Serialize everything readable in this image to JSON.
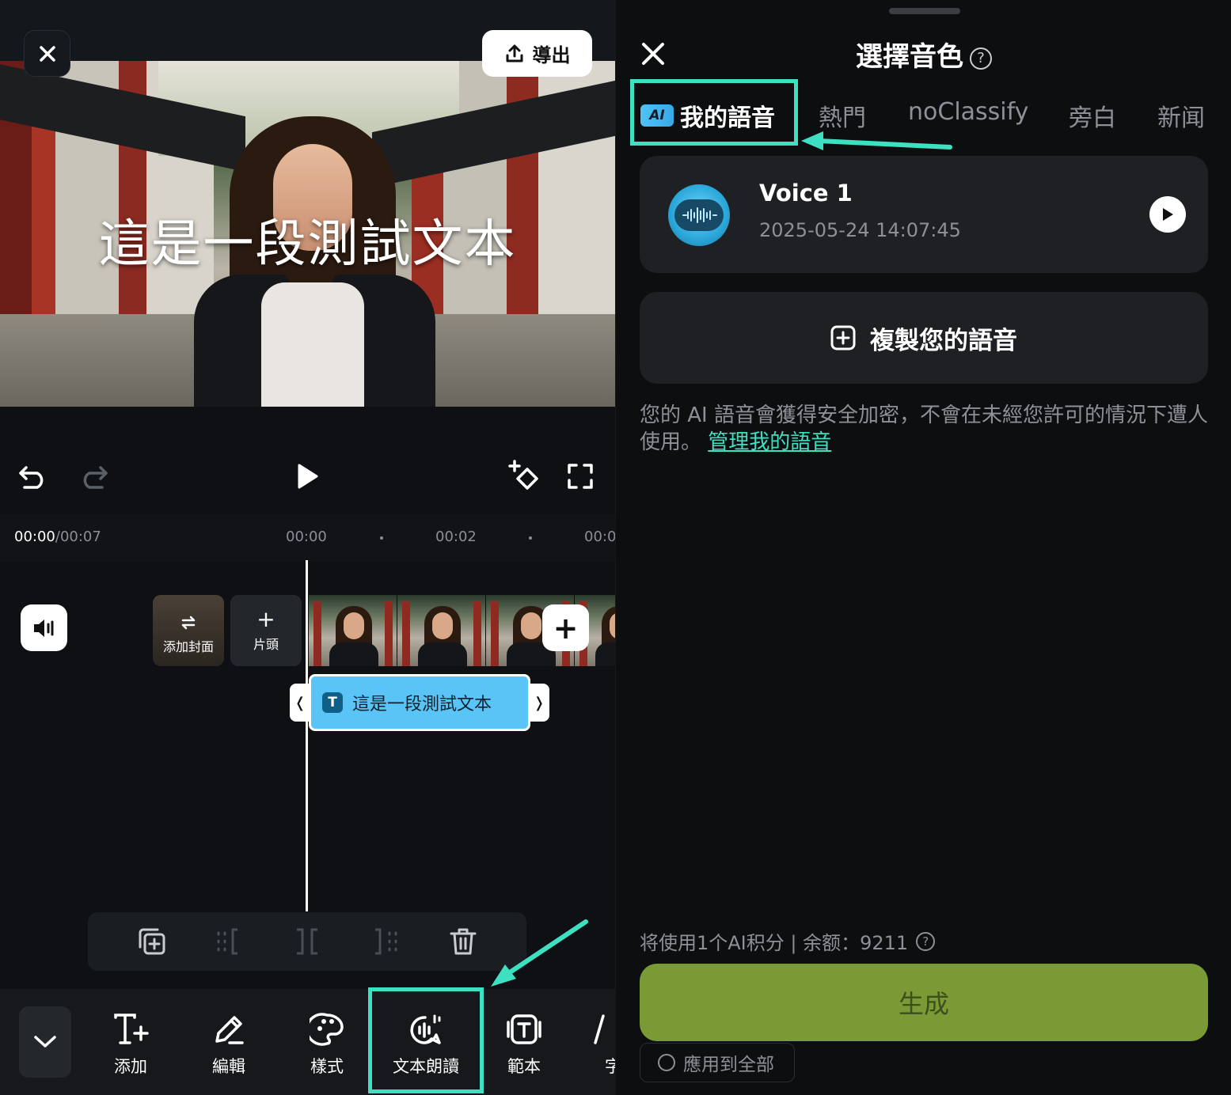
{
  "editor": {
    "export_label": "導出",
    "caption": "這是一段測試文本",
    "time_current": "00:00",
    "time_total": "/00:07",
    "ticks": [
      "00:00",
      "00:02",
      "00:0"
    ],
    "cover_label": "添加封面",
    "intro_label": "片頭",
    "text_clip_label": "這是一段測試文本",
    "text_clip_icon": "T",
    "tools": [
      {
        "label": "添加",
        "icon": "text-add-icon"
      },
      {
        "label": "編輯",
        "icon": "pencil-icon"
      },
      {
        "label": "樣式",
        "icon": "palette-icon"
      },
      {
        "label": "文本朗讀",
        "icon": "text-to-speech-icon"
      },
      {
        "label": "範本",
        "icon": "template-icon"
      },
      {
        "label": "字",
        "icon": "font-icon"
      }
    ]
  },
  "panel": {
    "title": "選擇音色",
    "help": "?",
    "tabs": [
      "我的語音",
      "熱門",
      "noClassify",
      "旁白",
      "新闻"
    ],
    "ai_badge": "AI",
    "voice": {
      "name": "Voice 1",
      "date": "2025-05-24 14:07:45"
    },
    "clone_label": "複製您的語音",
    "notice_text": "您的 AI 語音會獲得安全加密，不會在未經您許可的情況下遭人使用。",
    "notice_link": "管理我的語音",
    "credits_text": "将使用1个AI积分 | 余额：9211",
    "generate_label": "生成",
    "apply_all_label": "應用到全部"
  },
  "colors": {
    "accent": "#3de0c0",
    "generate_bg": "#7a9a35",
    "text_clip_bg": "#59c4f5"
  }
}
